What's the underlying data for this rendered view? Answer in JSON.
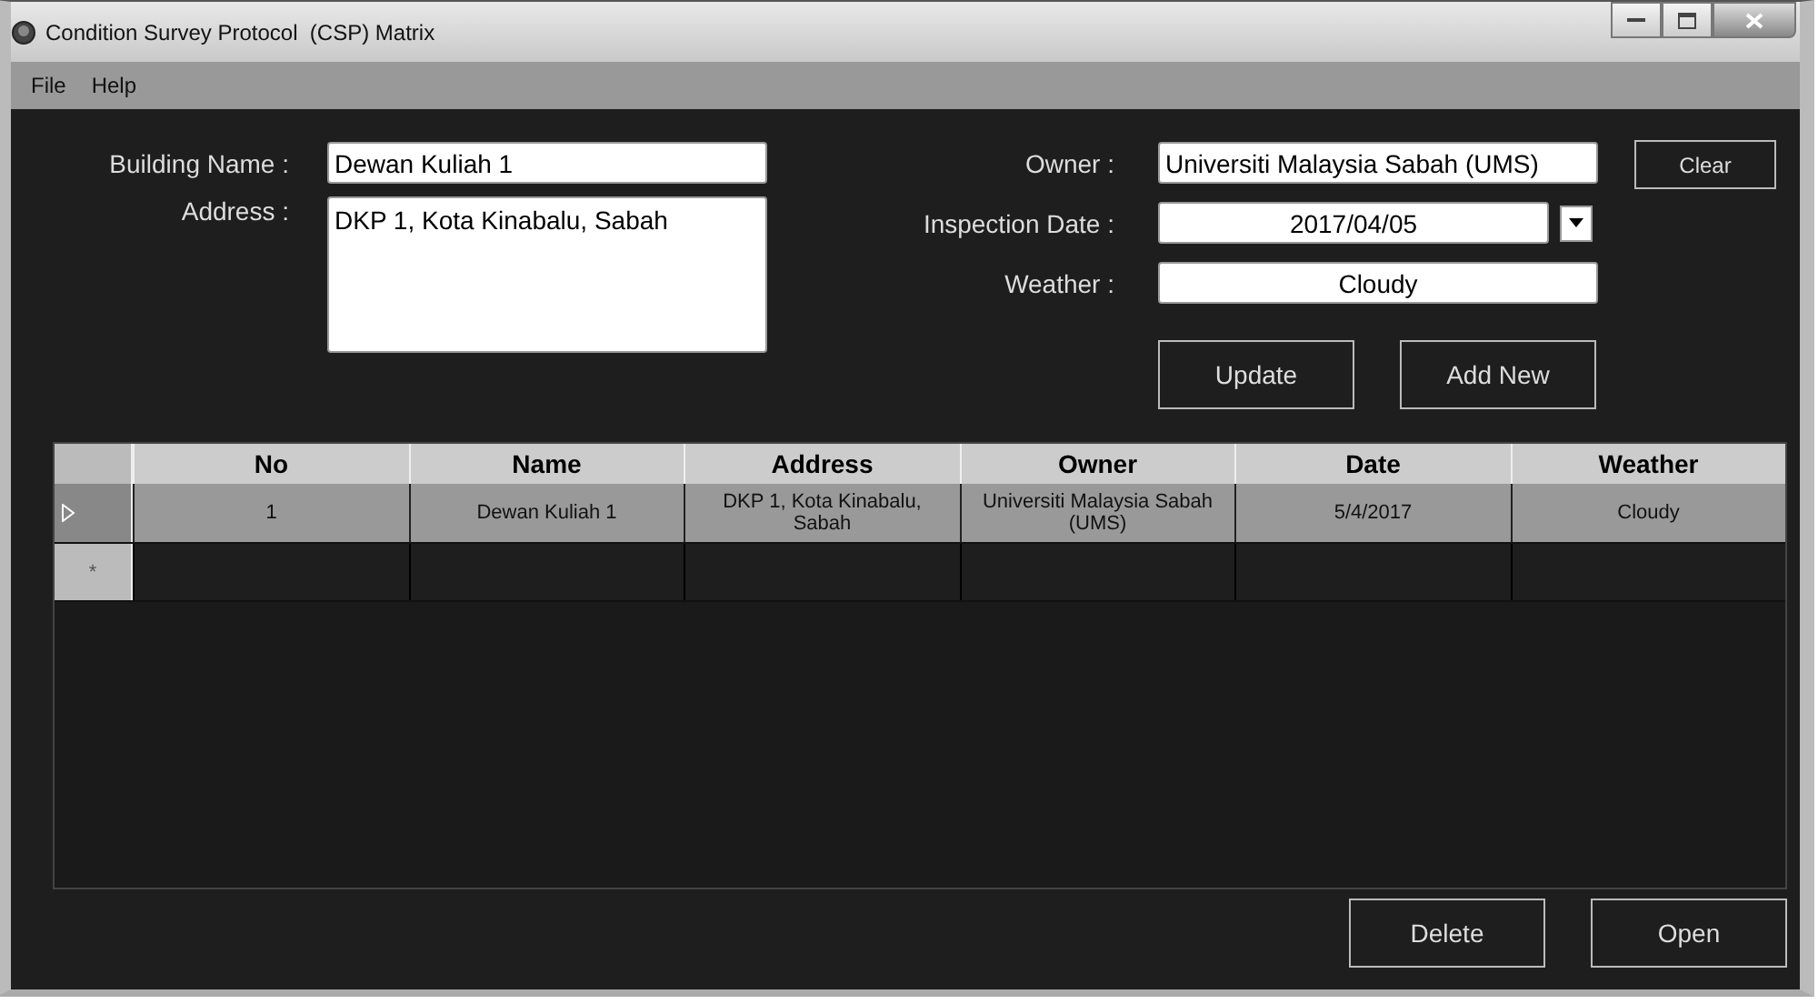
{
  "window": {
    "title": "Condition Survey Protocol  (CSP) Matrix"
  },
  "menu": [
    "File",
    "Help"
  ],
  "form": {
    "building_name": {
      "label": "Building Name :",
      "value": "Dewan Kuliah 1"
    },
    "address": {
      "label": "Address :",
      "value": "DKP 1, Kota Kinabalu, Sabah"
    },
    "owner": {
      "label": "Owner :",
      "value": "Universiti Malaysia Sabah (UMS)"
    },
    "inspection_date": {
      "label": "Inspection Date :",
      "value": "2017/04/05"
    },
    "weather": {
      "label": "Weather :",
      "value": "Cloudy"
    }
  },
  "buttons": {
    "clear": "Clear",
    "update": "Update",
    "add_new": "Add New",
    "delete": "Delete",
    "open": "Open"
  },
  "table": {
    "columns": [
      "No",
      "Name",
      "Address",
      "Owner",
      "Date",
      "Weather"
    ],
    "rows": [
      {
        "selected": true,
        "cells": [
          "1",
          "Dewan Kuliah 1",
          "DKP 1, Kota Kinabalu, Sabah",
          "Universiti Malaysia Sabah (UMS)",
          "5/4/2017",
          "Cloudy"
        ]
      }
    ],
    "new_row_marker": "*"
  }
}
